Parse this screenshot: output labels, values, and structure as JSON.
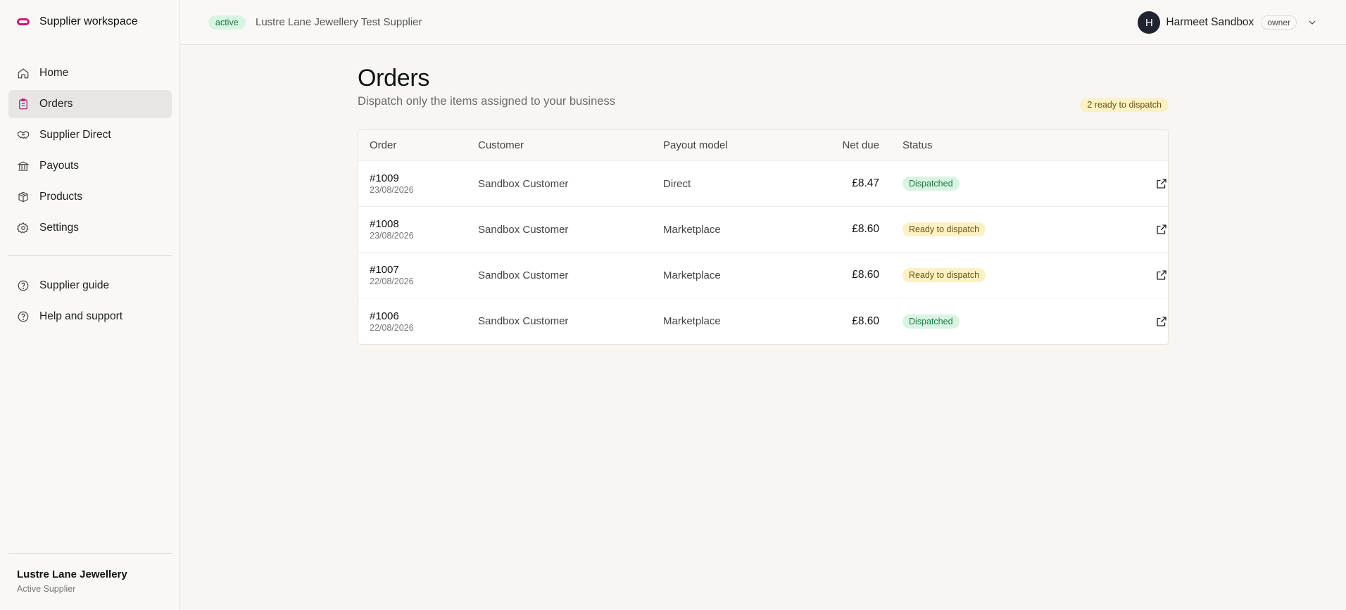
{
  "brand": {
    "name": "Supplier workspace",
    "color": "#c2187a"
  },
  "sidebar": {
    "items": [
      {
        "label": "Home",
        "icon": "home-icon",
        "active": false
      },
      {
        "label": "Orders",
        "icon": "clipboard-icon",
        "active": true
      },
      {
        "label": "Supplier Direct",
        "icon": "handshake-icon",
        "active": false
      },
      {
        "label": "Payouts",
        "icon": "bank-icon",
        "active": false
      },
      {
        "label": "Products",
        "icon": "box-icon",
        "active": false
      },
      {
        "label": "Settings",
        "icon": "gear-icon",
        "active": false
      }
    ],
    "secondary": [
      {
        "label": "Supplier guide",
        "icon": "help-circle-icon"
      },
      {
        "label": "Help and support",
        "icon": "help-circle-icon"
      }
    ],
    "footer": {
      "name": "Lustre Lane Jewellery",
      "subtitle": "Active Supplier"
    }
  },
  "topbar": {
    "status": "active",
    "supplier": "Lustre Lane Jewellery Test Supplier",
    "user": {
      "initial": "H",
      "name": "Harmeet Sandbox",
      "role": "owner"
    }
  },
  "page": {
    "title": "Orders",
    "subtitle": "Dispatch only the items assigned to your business",
    "ready_badge": "2 ready to dispatch"
  },
  "table": {
    "headers": {
      "order": "Order",
      "customer": "Customer",
      "payout": "Payout model",
      "net": "Net due",
      "status": "Status"
    },
    "rows": [
      {
        "order": "#1009",
        "date": "23/08/2026",
        "customer": "Sandbox Customer",
        "payout": "Direct",
        "net": "£8.47",
        "status": "Dispatched"
      },
      {
        "order": "#1008",
        "date": "23/08/2026",
        "customer": "Sandbox Customer",
        "payout": "Marketplace",
        "net": "£8.60",
        "status": "Ready to dispatch"
      },
      {
        "order": "#1007",
        "date": "22/08/2026",
        "customer": "Sandbox Customer",
        "payout": "Marketplace",
        "net": "£8.60",
        "status": "Ready to dispatch"
      },
      {
        "order": "#1006",
        "date": "22/08/2026",
        "customer": "Sandbox Customer",
        "payout": "Marketplace",
        "net": "£8.60",
        "status": "Dispatched"
      }
    ]
  },
  "colors": {
    "dispatched": "#d9f4e2",
    "ready": "#fbf1c4",
    "active_nav": "#e8e6e2"
  }
}
